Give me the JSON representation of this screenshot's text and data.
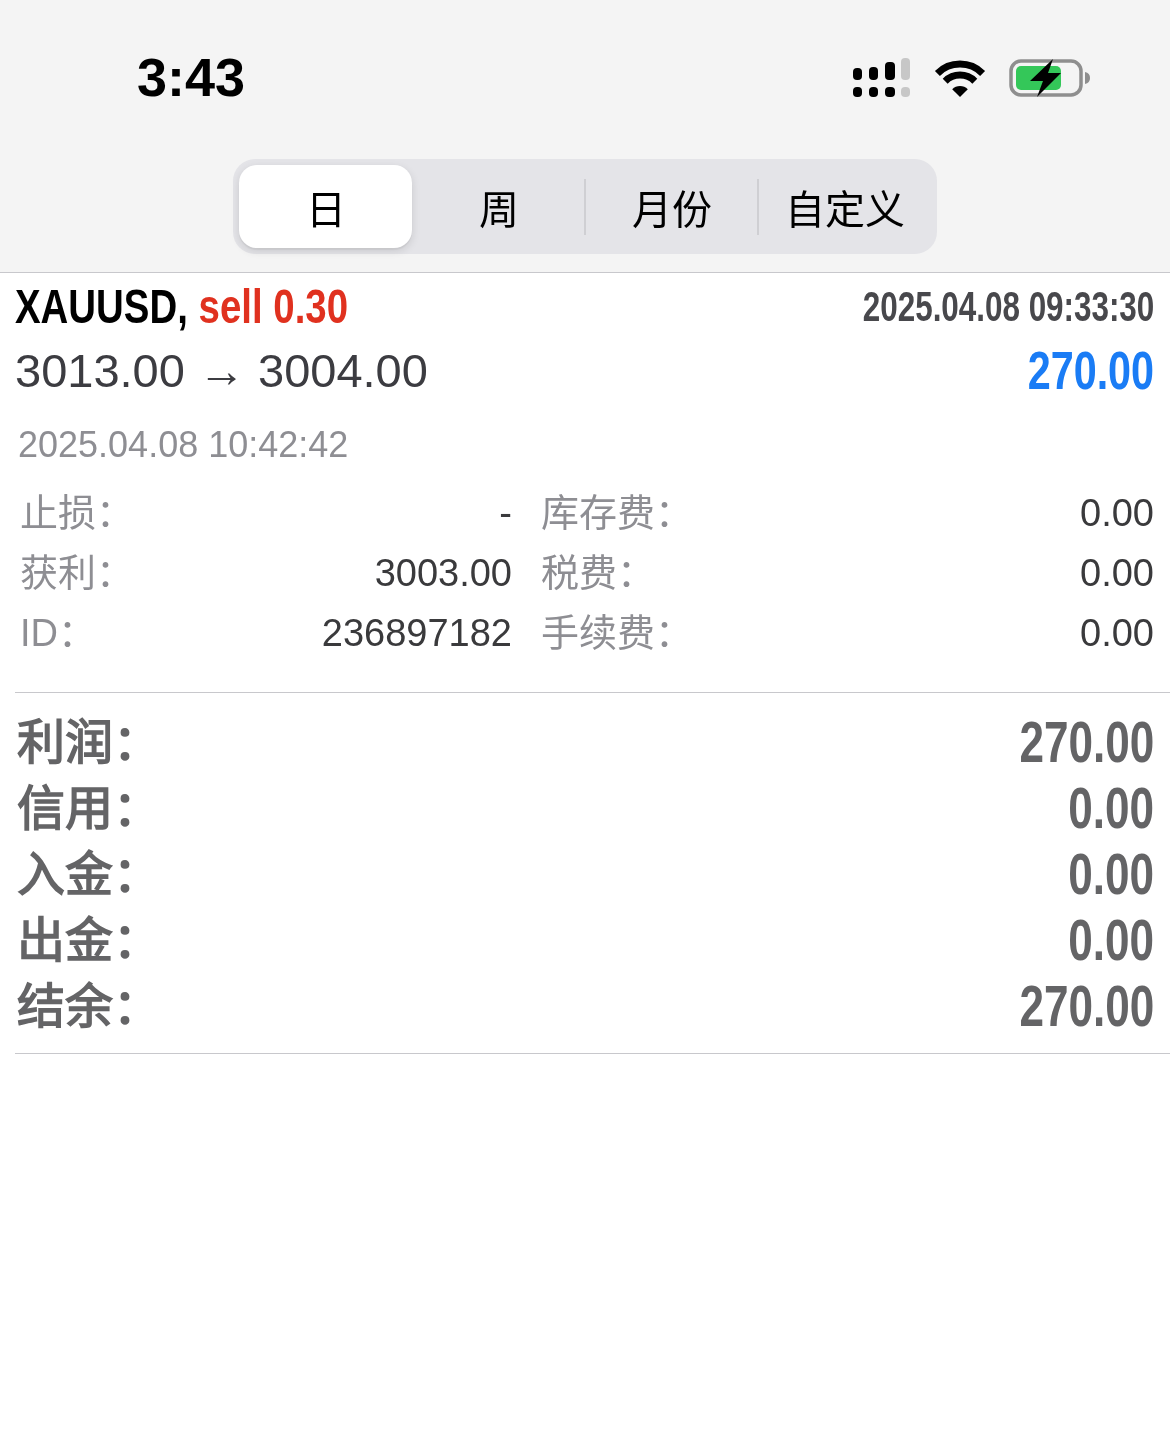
{
  "status_bar": {
    "time": "3:43"
  },
  "tabs": [
    {
      "label": "日",
      "selected": true
    },
    {
      "label": "周",
      "selected": false
    },
    {
      "label": "月份",
      "selected": false
    },
    {
      "label": "自定义",
      "selected": false
    }
  ],
  "order": {
    "symbol": "XAUUSD,",
    "type": "sell 0.30",
    "open_time": "2025.04.08 09:33:30",
    "prices": "3013.00 → 3004.00",
    "profit": "270.00",
    "close_time": "2025.04.08 10:42:42",
    "details": {
      "rows": [
        [
          "止损：",
          "-",
          "库存费：",
          "0.00"
        ],
        [
          "获利：",
          "3003.00",
          "税费：",
          "0.00"
        ],
        [
          "ID：",
          "236897182",
          "手续费：",
          "0.00"
        ]
      ]
    }
  },
  "summary": [
    {
      "label": "利润：",
      "value": "270.00"
    },
    {
      "label": "信用：",
      "value": "0.00"
    },
    {
      "label": "入金：",
      "value": "0.00"
    },
    {
      "label": "出金：",
      "value": "0.00"
    },
    {
      "label": "结余：",
      "value": "270.00"
    }
  ]
}
